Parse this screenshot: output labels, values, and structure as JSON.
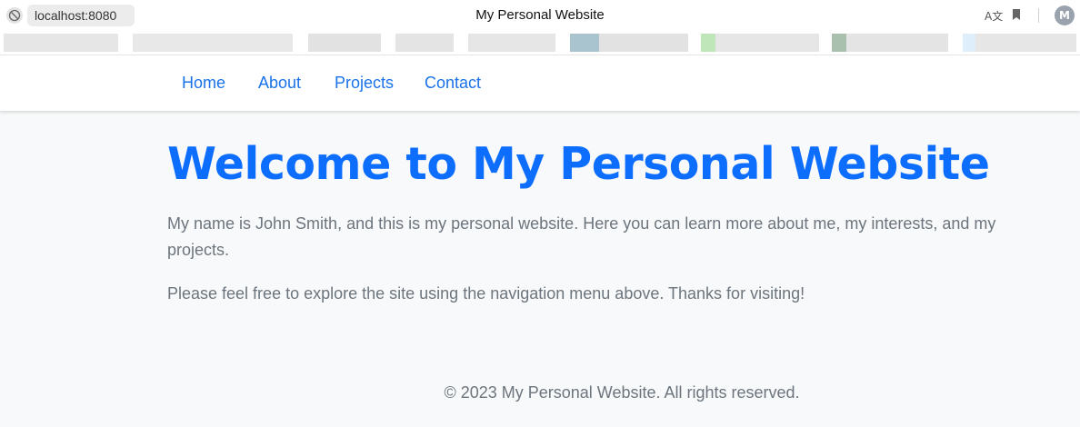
{
  "browser": {
    "url": "localhost:8080",
    "window_title": "My Personal Website",
    "profile_initial": "M",
    "icons": [
      "site-info-icon",
      "translate-icon",
      "bookmark-icon"
    ],
    "bookmark_colors": [
      "#e6e6e6",
      "#dcdcdc",
      "#a9c4cf",
      "#bfe6b8",
      "#a8c0ad",
      "#dfeefb"
    ]
  },
  "nav": {
    "items": [
      {
        "label": "Home"
      },
      {
        "label": "About"
      },
      {
        "label": "Projects"
      },
      {
        "label": "Contact"
      }
    ]
  },
  "main": {
    "title": "Welcome to My Personal Website",
    "paragraph1": "My name is John Smith, and this is my personal website. Here you can learn more about me, my interests, and my projects.",
    "paragraph2": "Please feel free to explore the site using the navigation menu above. Thanks for visiting!"
  },
  "footer": {
    "text": "© 2023 My Personal Website. All rights reserved."
  },
  "colors": {
    "accent": "#0d6efd",
    "nav_link": "#1a73e8",
    "muted_text": "#6c757d",
    "page_bg": "#f8f9fa"
  }
}
